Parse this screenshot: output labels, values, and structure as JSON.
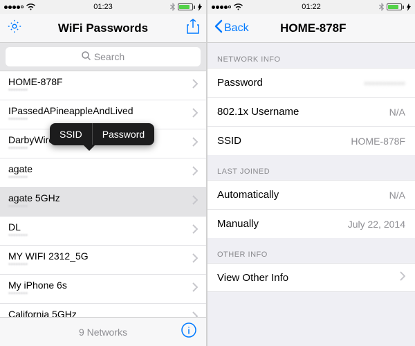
{
  "left": {
    "status": {
      "time": "01:23"
    },
    "title": "WiFi Passwords",
    "search_placeholder": "Search",
    "popup": {
      "ssid": "SSID",
      "password": "Password"
    },
    "networks": [
      {
        "name": "HOME-878F",
        "sub": "••••••••"
      },
      {
        "name": "IPassedAPineappleAndLived",
        "sub": "••••••••"
      },
      {
        "name": "DarbyWireless",
        "sub": "••••••••"
      },
      {
        "name": "agate",
        "sub": "••••••••"
      },
      {
        "name": "agate 5GHz",
        "sub": "••••••••",
        "selected": true
      },
      {
        "name": "DL",
        "sub": "••••••••"
      },
      {
        "name": "MY WIFI 2312_5G",
        "sub": "••••••••"
      },
      {
        "name": "My iPhone 6s",
        "sub": "••••••••"
      },
      {
        "name": "California 5GHz",
        "sub": "••••••••"
      }
    ],
    "footer": "9 Networks"
  },
  "right": {
    "status": {
      "time": "01:22"
    },
    "back": "Back",
    "title": "HOME-878F",
    "sections": {
      "network_info": {
        "header": "NETWORK INFO",
        "password_label": "Password",
        "password_value": "•••••••••••",
        "username_label": "802.1x Username",
        "username_value": "N/A",
        "ssid_label": "SSID",
        "ssid_value": "HOME-878F"
      },
      "last_joined": {
        "header": "LAST JOINED",
        "auto_label": "Automatically",
        "auto_value": "N/A",
        "manual_label": "Manually",
        "manual_value": "July 22, 2014"
      },
      "other_info": {
        "header": "OTHER INFO",
        "view_label": "View Other Info"
      }
    }
  }
}
